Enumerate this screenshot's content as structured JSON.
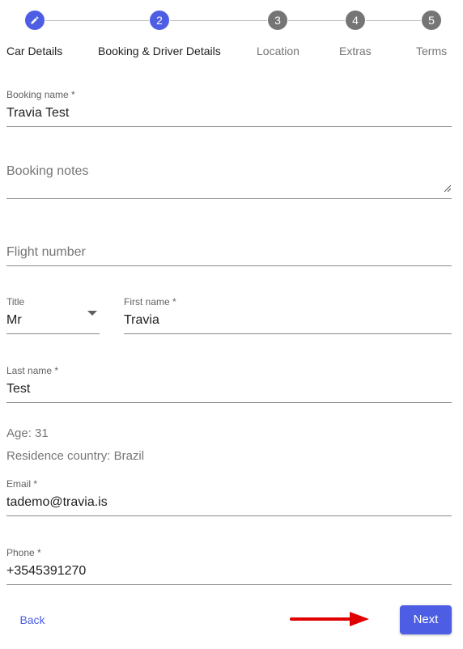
{
  "colors": {
    "accent": "#4e5ee4",
    "inactive_step": "#757575",
    "arrow": "#e00000"
  },
  "stepper": {
    "steps": [
      {
        "label": "Car Details",
        "icon": "pencil-icon"
      },
      {
        "label": "Booking & Driver Details",
        "number": "2"
      },
      {
        "label": "Location",
        "number": "3"
      },
      {
        "label": "Extras",
        "number": "4"
      },
      {
        "label": "Terms",
        "number": "5"
      }
    ]
  },
  "form": {
    "booking_name": {
      "label": "Booking name *",
      "value": "Travia Test"
    },
    "booking_notes": {
      "placeholder": "Booking notes"
    },
    "flight_number": {
      "placeholder": "Flight number"
    },
    "title": {
      "label": "Title",
      "value": "Mr"
    },
    "first_name": {
      "label": "First name *",
      "value": "Travia"
    },
    "last_name": {
      "label": "Last name *",
      "value": "Test"
    },
    "age": "Age: 31",
    "residence": "Residence country: Brazil",
    "email": {
      "label": "Email *",
      "value": "tademo@travia.is"
    },
    "phone": {
      "label": "Phone *",
      "value": "+3545391270"
    }
  },
  "actions": {
    "back_label": "Back",
    "next_label": "Next"
  }
}
